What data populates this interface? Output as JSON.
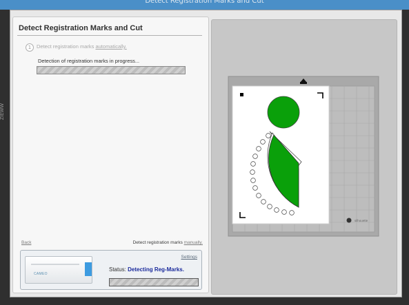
{
  "window": {
    "title": "Detect Registration Marks and Cut"
  },
  "left_edge": {
    "text": "ZIEWW"
  },
  "dialog": {
    "heading": "Detect Registration Marks and Cut",
    "step": {
      "number": "1",
      "text": "Detect registration marks",
      "link": "automatically."
    },
    "progress_label": "Detection of registration marks in progress...",
    "progress_fraction": null
  },
  "footer": {
    "back_label": "Back",
    "manual_prefix": "Detect registration marks",
    "manual_link": "manually."
  },
  "status_panel": {
    "settings_label": "Settings",
    "device_brand": "CAMEO",
    "status_prefix": "Status:",
    "status_value": "Detecting Reg-Marks."
  },
  "mat": {
    "brand_text": "silhouette"
  },
  "colors": {
    "shape_fill": "#0aa00a",
    "title_bar": "#4a8fc8",
    "status_text": "#1a2a9c"
  }
}
